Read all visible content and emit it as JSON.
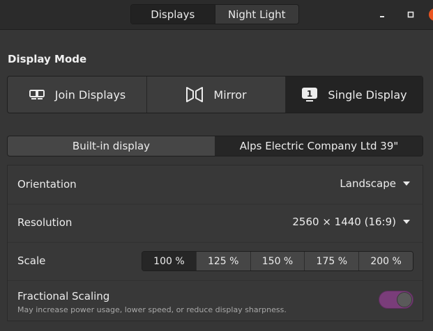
{
  "header": {
    "tabs": [
      {
        "label": "Displays",
        "active": true
      },
      {
        "label": "Night Light",
        "active": false
      }
    ]
  },
  "display_mode": {
    "title": "Display Mode",
    "options": [
      {
        "label": "Join Displays",
        "icon": "join-displays-icon",
        "selected": false
      },
      {
        "label": "Mirror",
        "icon": "mirror-icon",
        "selected": false
      },
      {
        "label": "Single Display",
        "icon": "single-display-icon",
        "badge": "1",
        "selected": true
      }
    ]
  },
  "monitors": {
    "tabs": [
      {
        "label": "Built-in display",
        "selected": false
      },
      {
        "label": "Alps Electric Company Ltd 39\"",
        "selected": true
      }
    ]
  },
  "settings": {
    "orientation": {
      "label": "Orientation",
      "value": "Landscape"
    },
    "resolution": {
      "label": "Resolution",
      "value": "2560 × 1440 (16:9)"
    },
    "scale": {
      "label": "Scale",
      "options": [
        "100 %",
        "125 %",
        "150 %",
        "175 %",
        "200 %"
      ],
      "selected": "100 %"
    },
    "fractional_scaling": {
      "title": "Fractional Scaling",
      "description": "May increase power usage, lower speed, or reduce display sharpness.",
      "enabled": true
    }
  },
  "colors": {
    "accent_toggle": "#7a3d7a",
    "window_close": "#e95420"
  }
}
